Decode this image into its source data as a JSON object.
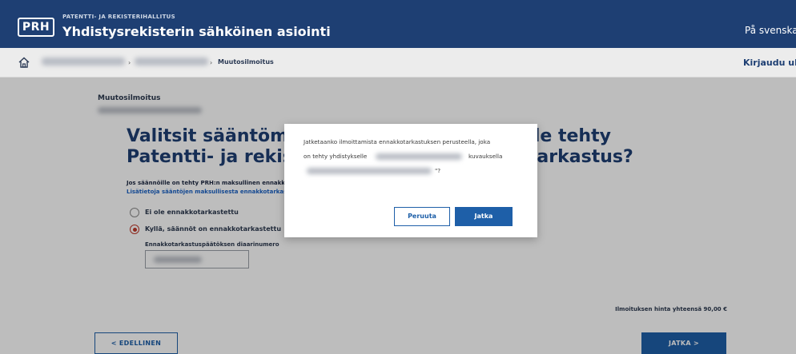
{
  "header": {
    "logo_text": "PRH",
    "org_name": "PATENTTI- JA REKISTERIHALLITUS",
    "app_title": "Yhdistysrekisterin sähköinen asiointi",
    "language_link": "På svenska"
  },
  "breadcrumb": {
    "current": "Muutosilmoitus",
    "login_link": "Kirjaudu ulos"
  },
  "form": {
    "section_label": "Muutosilmoitus",
    "title_line1": "Valitsit sääntömuutoksen. Onko säännöille tehty",
    "title_line2": "Patentti- ja rekisterihallituksen ennakkotarkastus?",
    "hint": "Jos säännöille on tehty PRH:n maksullinen ennakkotarkastus",
    "info_link": "Lisätietoja sääntöjen maksullisesta ennakkotarkastuksesta",
    "option_no": "Ei ole ennakkotarkastettu",
    "option_yes": "Kyllä, säännöt on ennakkotarkastettu",
    "field_label": "Ennakkotarkastuspäätöksen diaarinumero",
    "price": "Ilmoituksen hinta yhteensä 90,00 €",
    "back_button": "< EDELLINEN",
    "next_button": "JATKA >"
  },
  "modal": {
    "text_line1": "Jatketaanko ilmoittamista ennakkotarkastuksen perusteella, joka",
    "text_line2_start": "on tehty yhdistykselle",
    "text_line2_end": "kuvauksella",
    "text_line3_end": "\"?",
    "cancel_button": "Peruuta",
    "confirm_button": "Jatka"
  },
  "colors": {
    "brand_navy": "#1e3f73",
    "primary_blue": "#1e5fa8",
    "radio_selected": "#c0392b"
  }
}
